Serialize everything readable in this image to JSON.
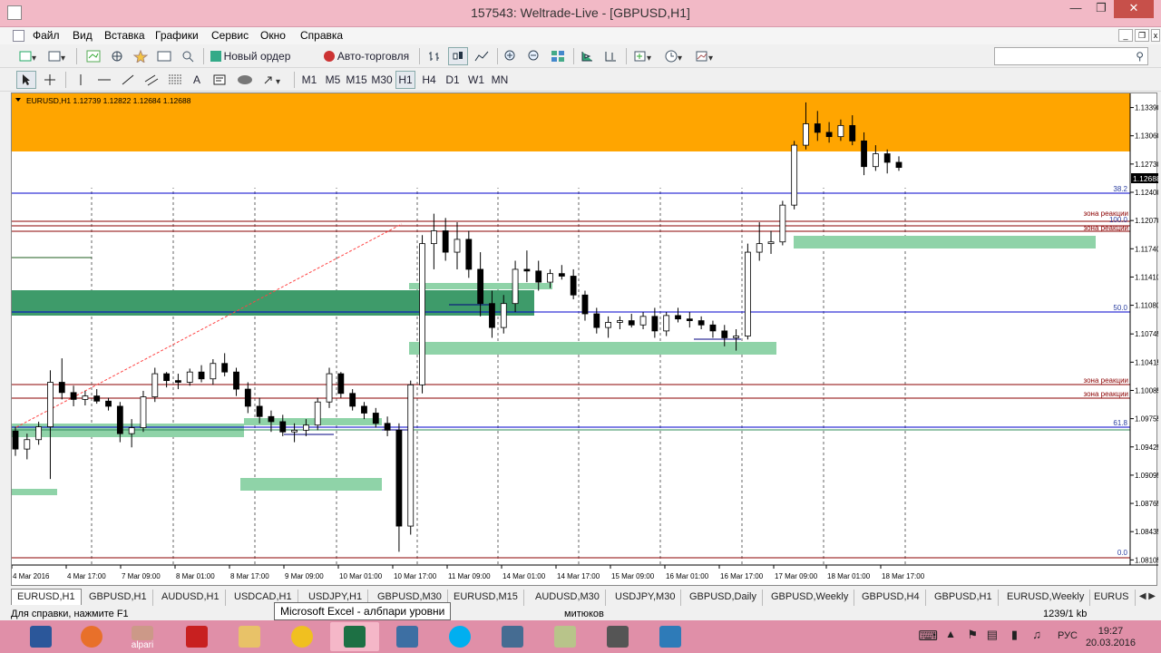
{
  "window": {
    "title": "157543: Weltrade-Live - [GBPUSD,H1]"
  },
  "menu": [
    "Файл",
    "Вид",
    "Вставка",
    "Графики",
    "Сервис",
    "Окно",
    "Справка"
  ],
  "toolbar": {
    "new_order": "Новый ордер",
    "auto_trading": "Авто-торговля"
  },
  "drawing_tools": {
    "text_tool": "A"
  },
  "timeframes": [
    "M1",
    "M5",
    "M15",
    "M30",
    "H1",
    "H4",
    "D1",
    "W1",
    "MN"
  ],
  "active_timeframe": "H1",
  "chart": {
    "header": "EURUSD,H1  1.12739 1.12822 1.12684 1.12688",
    "current_price_label": "1.12688",
    "price_ticks": [
      "1.13390",
      "1.13060",
      "1.12730",
      "1.12400",
      "1.12070",
      "1.11740",
      "1.11410",
      "1.11080",
      "1.10745",
      "1.10415",
      "1.10085",
      "1.09755",
      "1.09425",
      "1.09095",
      "1.08765",
      "1.08435",
      "1.08105"
    ],
    "time_ticks": [
      "4 Mar 2016",
      "4 Mar 17:00",
      "7 Mar 09:00",
      "8 Mar 01:00",
      "8 Mar 17:00",
      "9 Mar 09:00",
      "10 Mar 01:00",
      "10 Mar 17:00",
      "11 Mar 09:00",
      "14 Mar 01:00",
      "14 Mar 17:00",
      "15 Mar 09:00",
      "16 Mar 01:00",
      "16 Mar 17:00",
      "17 Mar 09:00",
      "18 Mar 01:00",
      "18 Mar 17:00"
    ],
    "fib_labels": {
      "f382": "38.2",
      "f100": "100.0",
      "f500": "50.0",
      "f618": "61.8",
      "f0": "0.0"
    },
    "zone_label": "зона реакции",
    "colors": {
      "supply_zone": "#ffa500",
      "demand_zone_light": "#8fd3a8",
      "demand_zone_dark": "#3e9b6a",
      "fib_line": "#0000cc",
      "zone_line": "#8b0000",
      "trend_line": "#ff4444"
    },
    "ohlc_series": [
      [
        1.0961,
        1.0966,
        1.0932,
        1.094
      ],
      [
        1.094,
        1.0958,
        1.0928,
        1.0951
      ],
      [
        1.0951,
        1.0972,
        1.0945,
        1.0966
      ],
      [
        1.0966,
        1.1032,
        1.0905,
        1.1018
      ],
      [
        1.1018,
        1.1046,
        1.0998,
        1.1006
      ],
      [
        1.1006,
        1.1014,
        1.099,
        1.0998
      ],
      [
        1.0998,
        1.1008,
        1.0991,
        1.1002
      ],
      [
        1.1002,
        1.101,
        1.0993,
        1.0996
      ],
      [
        1.0996,
        1.1,
        1.0985,
        1.099
      ],
      [
        1.099,
        1.0995,
        1.0948,
        1.0958
      ],
      [
        1.0958,
        1.0975,
        1.0942,
        1.0965
      ],
      [
        1.0965,
        1.1008,
        1.096,
        1.1001
      ],
      [
        1.1001,
        1.1035,
        1.0995,
        1.1028
      ],
      [
        1.1028,
        1.103,
        1.1012,
        1.102
      ],
      [
        1.102,
        1.1028,
        1.101,
        1.1018
      ],
      [
        1.1018,
        1.1034,
        1.1014,
        1.103
      ],
      [
        1.103,
        1.1038,
        1.1018,
        1.1022
      ],
      [
        1.1022,
        1.1045,
        1.1015,
        1.104
      ],
      [
        1.104,
        1.1052,
        1.1025,
        1.103
      ],
      [
        1.103,
        1.1035,
        1.1002,
        1.101
      ],
      [
        1.101,
        1.1018,
        1.0982,
        1.099
      ],
      [
        1.099,
        1.1,
        1.097,
        1.0978
      ],
      [
        1.0978,
        1.0985,
        1.096,
        1.0972
      ],
      [
        1.0972,
        1.098,
        1.0955,
        1.096
      ],
      [
        1.096,
        1.097,
        1.0948,
        1.0962
      ],
      [
        1.0962,
        1.0975,
        1.0955,
        1.0968
      ],
      [
        1.0968,
        1.1,
        1.0962,
        1.0995
      ],
      [
        1.0995,
        1.1035,
        1.0988,
        1.1028
      ],
      [
        1.1028,
        1.103,
        1.1,
        1.1005
      ],
      [
        1.1005,
        1.101,
        1.0985,
        1.099
      ],
      [
        1.099,
        1.0995,
        1.0975,
        1.0982
      ],
      [
        1.0982,
        1.0988,
        1.0965,
        1.097
      ],
      [
        1.097,
        1.0978,
        1.0955,
        1.0962
      ],
      [
        1.0962,
        1.097,
        1.082,
        1.085
      ],
      [
        1.085,
        1.102,
        1.084,
        1.1015
      ],
      [
        1.1015,
        1.119,
        1.1005,
        1.118
      ],
      [
        1.118,
        1.1215,
        1.115,
        1.1195
      ],
      [
        1.1195,
        1.121,
        1.116,
        1.117
      ],
      [
        1.117,
        1.1205,
        1.115,
        1.1185
      ],
      [
        1.1185,
        1.1195,
        1.114,
        1.115
      ],
      [
        1.115,
        1.117,
        1.1095,
        1.111
      ],
      [
        1.111,
        1.1125,
        1.107,
        1.1082
      ],
      [
        1.1082,
        1.112,
        1.1075,
        1.111
      ],
      [
        1.111,
        1.116,
        1.11,
        1.115
      ],
      [
        1.115,
        1.1172,
        1.1135,
        1.1148
      ],
      [
        1.1148,
        1.116,
        1.1125,
        1.1135
      ],
      [
        1.1135,
        1.115,
        1.1128,
        1.1145
      ],
      [
        1.1145,
        1.1155,
        1.1138,
        1.1142
      ],
      [
        1.1142,
        1.115,
        1.1115,
        1.112
      ],
      [
        1.112,
        1.1125,
        1.109,
        1.1098
      ],
      [
        1.1098,
        1.1105,
        1.1075,
        1.1082
      ],
      [
        1.1082,
        1.1095,
        1.107,
        1.1088
      ],
      [
        1.1088,
        1.1095,
        1.108,
        1.109
      ],
      [
        1.109,
        1.1098,
        1.1082,
        1.1085
      ],
      [
        1.1085,
        1.11,
        1.108,
        1.1095
      ],
      [
        1.1095,
        1.1105,
        1.107,
        1.1078
      ],
      [
        1.1078,
        1.11,
        1.1072,
        1.1096
      ],
      [
        1.1096,
        1.1105,
        1.1088,
        1.1092
      ],
      [
        1.1092,
        1.11,
        1.1082,
        1.109
      ],
      [
        1.109,
        1.1095,
        1.108,
        1.1085
      ],
      [
        1.1085,
        1.109,
        1.107,
        1.1078
      ],
      [
        1.1078,
        1.1085,
        1.106,
        1.107
      ],
      [
        1.107,
        1.108,
        1.1055,
        1.1072
      ],
      [
        1.1072,
        1.118,
        1.1068,
        1.117
      ],
      [
        1.117,
        1.1205,
        1.116,
        1.118
      ],
      [
        1.118,
        1.1195,
        1.1168,
        1.1182
      ],
      [
        1.1182,
        1.123,
        1.1178,
        1.1225
      ],
      [
        1.1225,
        1.13,
        1.122,
        1.1295
      ],
      [
        1.1295,
        1.1345,
        1.129,
        1.132
      ],
      [
        1.132,
        1.1335,
        1.13,
        1.131
      ],
      [
        1.131,
        1.1322,
        1.1298,
        1.1305
      ],
      [
        1.1305,
        1.1325,
        1.13,
        1.1318
      ],
      [
        1.1318,
        1.133,
        1.1295,
        1.13
      ],
      [
        1.13,
        1.131,
        1.126,
        1.127
      ],
      [
        1.127,
        1.1295,
        1.1265,
        1.1285
      ],
      [
        1.1285,
        1.129,
        1.1262,
        1.1275
      ],
      [
        1.1275,
        1.1282,
        1.1265,
        1.1269
      ]
    ]
  },
  "tabs": [
    "EURUSD,H1",
    "GBPUSD,H1",
    "AUDUSD,H1",
    "USDCAD,H1",
    "USDJPY,H1",
    "GBPUSD,M30",
    "EURUSD,M15",
    "AUDUSD,M30",
    "USDJPY,M30",
    "GBPUSD,Daily",
    "GBPUSD,Weekly",
    "GBPUSD,H4",
    "GBPUSD,H1",
    "EURUSD,Weekly",
    "EURUS"
  ],
  "tooltip": "Microsoft Excel - албпари уровни",
  "status": {
    "help": "Для справки, нажмите F1",
    "profile": "митюков",
    "traffic": "1239/1 kb"
  },
  "taskbar": {
    "alpari_label": "alpari",
    "lang": "РУС",
    "time": "19:27",
    "date": "20.03.2016"
  }
}
